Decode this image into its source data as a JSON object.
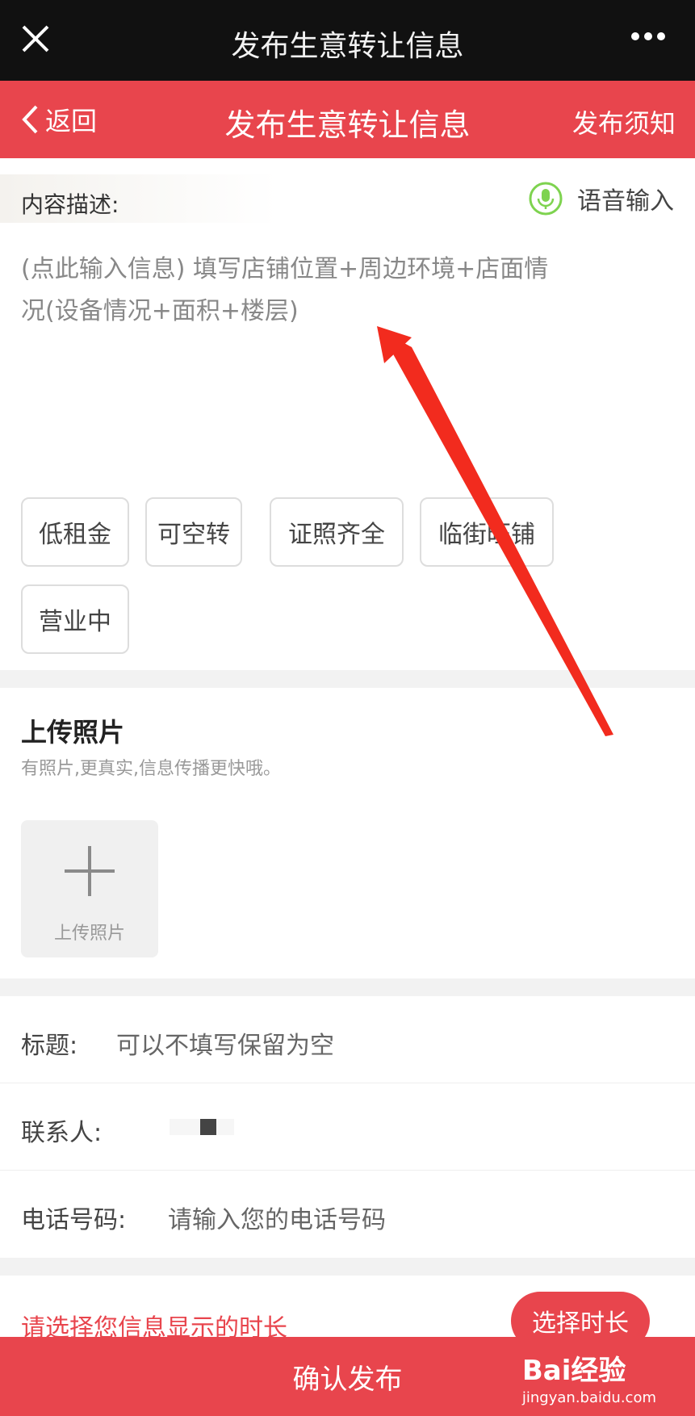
{
  "topbar": {
    "title": "发布生意转让信息"
  },
  "navbar": {
    "back": "返回",
    "title": "发布生意转让信息",
    "notice": "发布须知"
  },
  "description": {
    "label": "内容描述:",
    "voice": "语音输入",
    "placeholder_line1": "(点此输入信息)  填写店铺位置+周边环境+店面情",
    "placeholder_line2": "况(设备情况+面积+楼层)"
  },
  "tags": [
    "低租金",
    "可空转",
    "证照齐全",
    "临街旺铺",
    "营业中"
  ],
  "upload": {
    "title": "上传照片",
    "subtitle": "有照片,更真实,信息传播更快哦。",
    "button": "上传照片"
  },
  "form": {
    "title_label": "标题:",
    "title_placeholder": "可以不填写保留为空",
    "contact_label": "联系人:",
    "phone_label": "电话号码:",
    "phone_placeholder": "请输入您的电话号码"
  },
  "duration": {
    "prompt": "请选择您信息显示的时长",
    "button": "选择时长"
  },
  "confirm": "确认发布",
  "watermark": {
    "brand": "Bai经验",
    "url": "jingyan.baidu.com"
  },
  "colors": {
    "accent": "#e8454d",
    "topbar": "#111111",
    "mic": "#7ed34f"
  }
}
